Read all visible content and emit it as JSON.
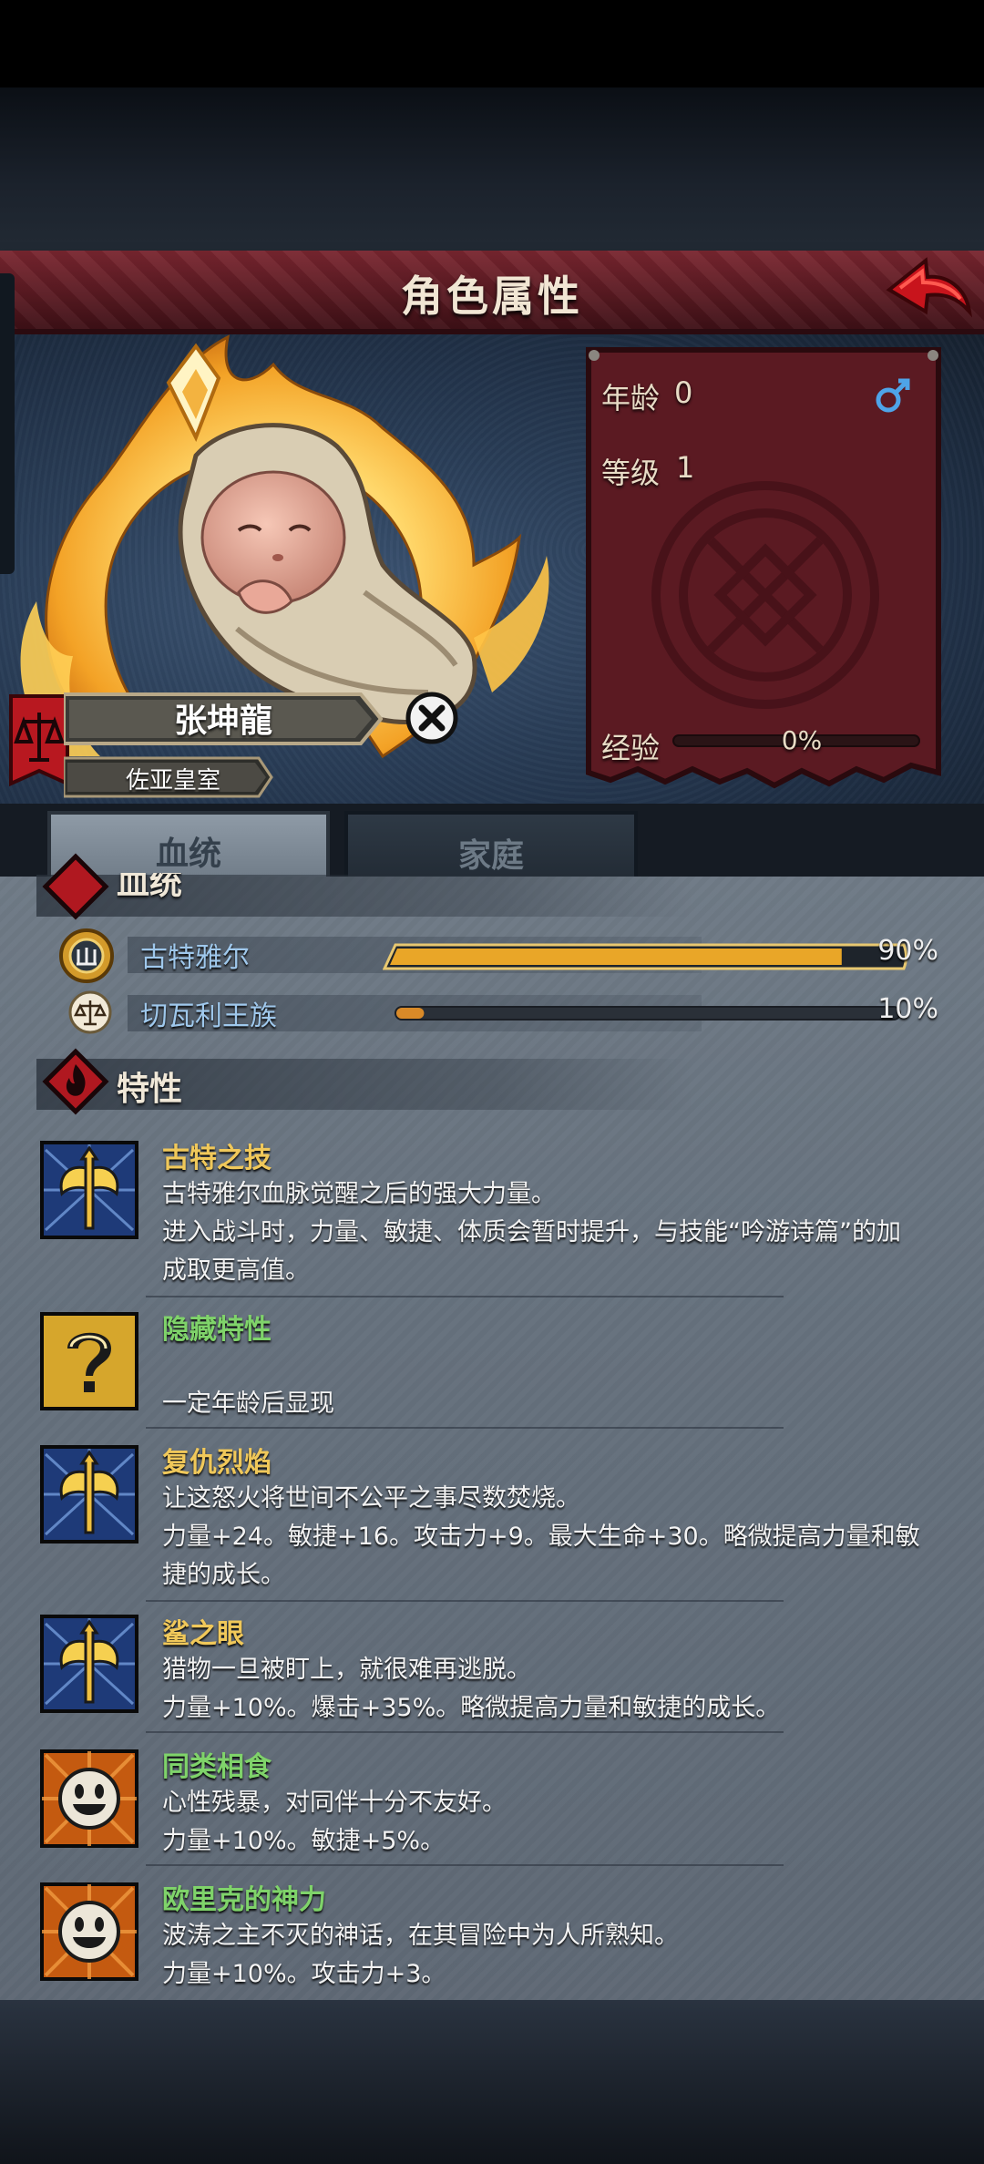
{
  "header": {
    "title": "角色属性"
  },
  "character": {
    "name": "张坤龍",
    "house": "佐亚皇室"
  },
  "stats": {
    "age_label": "年龄",
    "age_value": "0",
    "level_label": "等级",
    "level_value": "1",
    "exp_label": "经验",
    "exp_value": "0%",
    "exp_fraction": 0,
    "gender_icon": "male-icon"
  },
  "tabs": [
    {
      "label": "血统",
      "active": true
    },
    {
      "label": "家庭",
      "active": false
    }
  ],
  "bloodline": {
    "section_title": "血统",
    "items": [
      {
        "name": "古特雅尔",
        "percent": "90%",
        "fraction": 0.9,
        "icon": "gutyar-crest-icon"
      },
      {
        "name": "切瓦利王族",
        "percent": "10%",
        "fraction": 0.1,
        "icon": "scales-crest-icon"
      }
    ]
  },
  "traits": {
    "section_title": "特性",
    "items": [
      {
        "title": "古特之技",
        "title_color": "#f0c85a",
        "icon": "axe-trait-icon",
        "lines": [
          "古特雅尔血脉觉醒之后的强大力量。",
          "进入战斗时，力量、敏捷、体质会暂时提升，与技能“吟游诗篇”的加",
          "成取更高值。"
        ]
      },
      {
        "title": "隐藏特性",
        "title_color": "#7fd36a",
        "icon": "question-trait-icon",
        "lines": [
          "一定年龄后显现"
        ]
      },
      {
        "title": "复仇烈焰",
        "title_color": "#f0c85a",
        "icon": "axe-trait-icon",
        "lines": [
          "让这怒火将世间不公平之事尽数焚烧。",
          "力量+24。敏捷+16。攻击力+9。最大生命+30。略微提高力量和敏",
          "捷的成长。"
        ]
      },
      {
        "title": "鲨之眼",
        "title_color": "#f0c85a",
        "icon": "axe-trait-icon",
        "lines": [
          "猎物一旦被盯上，就很难再逃脱。",
          "力量+10%。爆击+35%。略微提高力量和敏捷的成长。"
        ]
      },
      {
        "title": "同类相食",
        "title_color": "#7fd36a",
        "icon": "smiley-trait-icon",
        "lines": [
          "心性残暴，对同伴十分不友好。",
          "力量+10%。敏捷+5%。"
        ]
      },
      {
        "title": "欧里克的神力",
        "title_color": "#7fd36a",
        "icon": "smiley-trait-icon",
        "lines": [
          "波涛之主不灭的神话，在其冒险中为人所熟知。",
          "力量+10%。攻击力+3。"
        ]
      }
    ]
  }
}
